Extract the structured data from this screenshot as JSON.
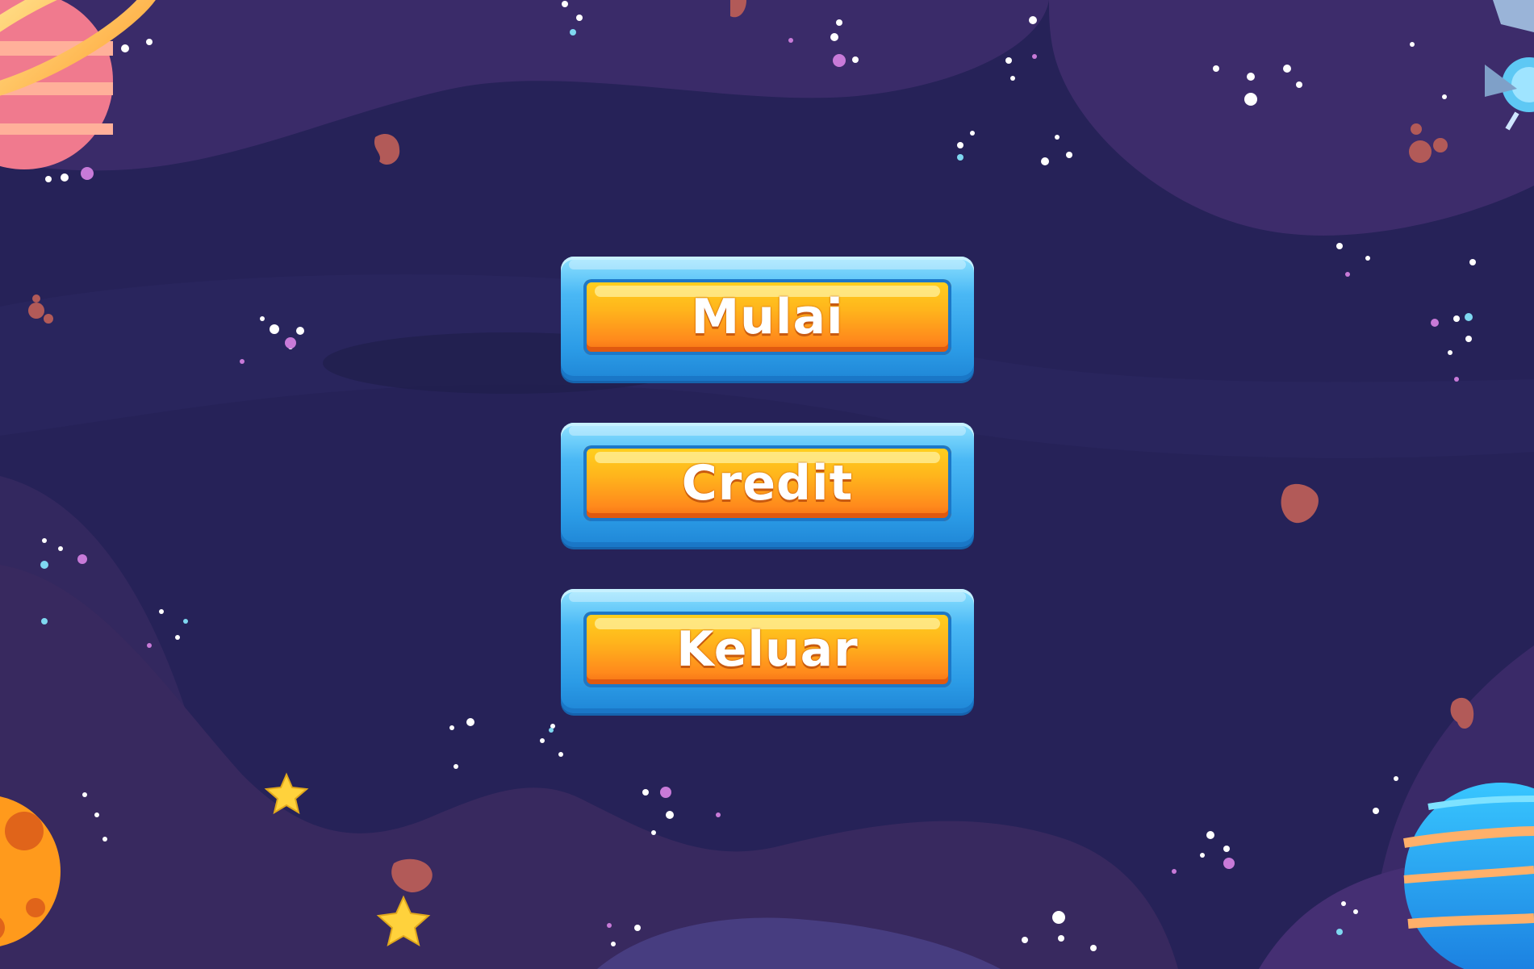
{
  "menu": {
    "start_label": "Mulai",
    "credit_label": "Credit",
    "exit_label": "Keluar"
  },
  "colors": {
    "background": "#262258",
    "nebula": "#3a2a6a",
    "button_frame": "#3ab0f0",
    "button_core": "#ff9e1c",
    "button_text": "#ffffff"
  },
  "decorations": [
    "ringed-planet-icon",
    "orange-planet-icon",
    "blue-planet-icon",
    "satellite-icon",
    "asteroid-icon",
    "star-icon"
  ]
}
